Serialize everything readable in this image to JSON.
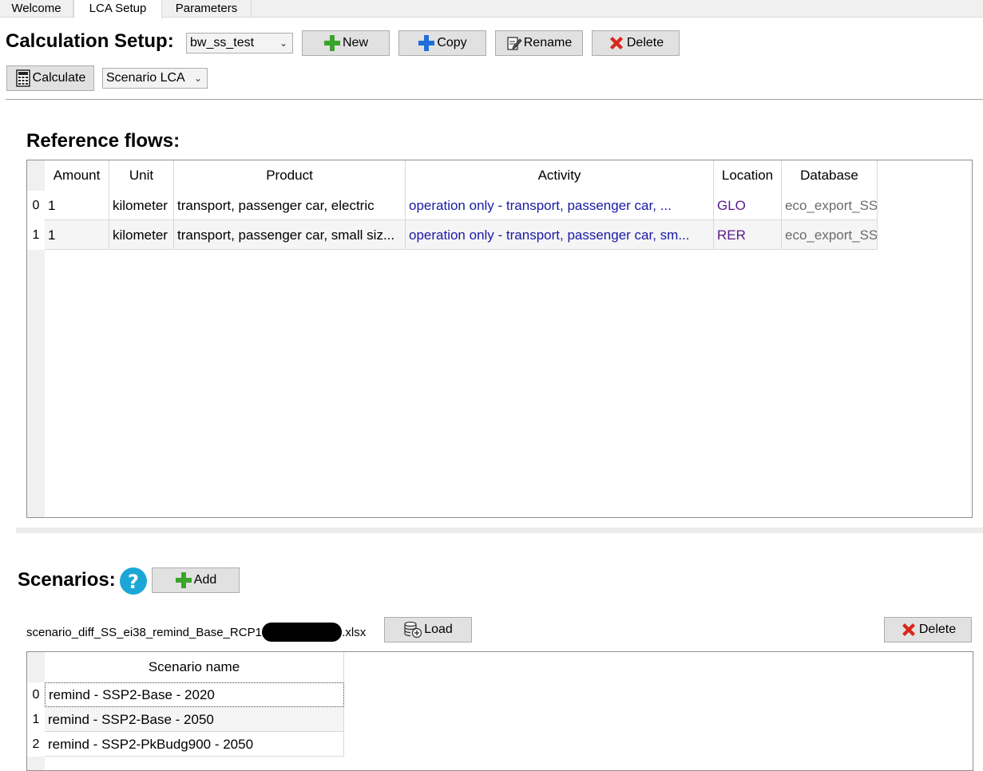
{
  "tabs": [
    "Welcome",
    "LCA Setup",
    "Parameters"
  ],
  "calc_setup": {
    "title": "Calculation Setup:",
    "selected": "bw_ss_test",
    "new_label": "New",
    "copy_label": "Copy",
    "rename_label": "Rename",
    "delete_label": "Delete",
    "calculate_label": "Calculate",
    "mode_selected": "Scenario LCA"
  },
  "reference_flows": {
    "title": "Reference flows:",
    "columns": [
      "Amount",
      "Unit",
      "Product",
      "Activity",
      "Location",
      "Database"
    ],
    "rows": [
      {
        "index": "0",
        "amount": "1",
        "unit": "kilometer",
        "product": "transport, passenger car, electric",
        "activity": "operation only - transport, passenger car, ...",
        "location": "GLO",
        "database": "eco_export_SS"
      },
      {
        "index": "1",
        "amount": "1",
        "unit": "kilometer",
        "product": "transport, passenger car, small siz...",
        "activity": "operation only - transport, passenger car, sm...",
        "location": "RER",
        "database": "eco_export_SS"
      }
    ]
  },
  "scenarios": {
    "title": "Scenarios:",
    "add_label": "Add",
    "file_name_prefix": "scenario_diff_SS_ei38_remind_Base_RCP19",
    "file_name_suffix": ".xlsx",
    "load_label": "Load",
    "delete_label": "Delete",
    "column": "Scenario name",
    "rows": [
      {
        "index": "0",
        "name": "remind - SSP2-Base - 2020"
      },
      {
        "index": "1",
        "name": "remind - SSP2-Base - 2050"
      },
      {
        "index": "2",
        "name": "remind - SSP2-PkBudg900 - 2050"
      }
    ]
  },
  "icons": {
    "new": "plus-icon",
    "copy": "plus-icon",
    "rename": "edit-icon",
    "delete": "delete-x-icon",
    "calculate": "calculator-icon",
    "help": "help-icon",
    "load": "database-add-icon"
  },
  "colors": {
    "plus_green": "#3aa52b",
    "plus_blue": "#1e6fd9",
    "delete_red": "#d9261c",
    "help_cyan": "#1ca6d8",
    "activity_blue": "#1a1aa6",
    "location_purple": "#5b1a8c"
  }
}
